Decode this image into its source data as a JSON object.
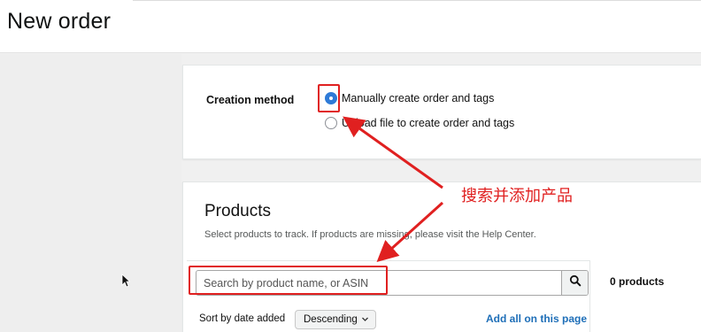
{
  "header": {
    "title": "New order"
  },
  "creation_method": {
    "label": "Creation method",
    "options": [
      {
        "label": "Manually create order and tags",
        "selected": true
      },
      {
        "label": "Upload file to create order and tags",
        "selected": false
      }
    ]
  },
  "products": {
    "title": "Products",
    "subtitle": "Select products to track. If products are missing, please visit the Help Center.",
    "search": {
      "placeholder": "Search by product name, or ASIN",
      "icon": "search-icon"
    },
    "sort": {
      "label": "Sort by date added",
      "value": "Descending"
    },
    "add_all_label": "Add all on this page",
    "count_label": "0 products"
  },
  "annotation": {
    "text": "搜索并添加产品",
    "color": "#e02020"
  },
  "colors": {
    "accent": "#2f7ad7",
    "link": "#1f6fb8",
    "annotation": "#e02020"
  }
}
